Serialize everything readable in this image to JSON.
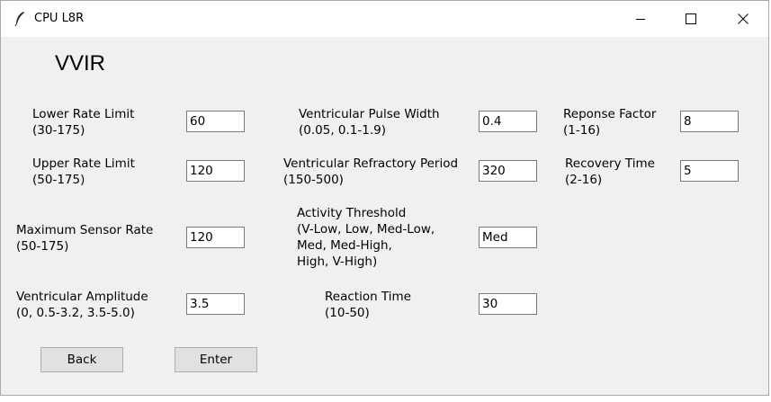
{
  "window": {
    "title": "CPU L8R",
    "icons": {
      "app": "feather-icon",
      "minimize": "minimize-icon",
      "maximize": "maximize-icon",
      "close": "close-icon"
    }
  },
  "mode_title": "VVIR",
  "fields": {
    "lower_rate_limit": {
      "label": "Lower Rate Limit\n(30-175)",
      "value": "60"
    },
    "upper_rate_limit": {
      "label": "Upper Rate Limit\n(50-175)",
      "value": "120"
    },
    "maximum_sensor_rate": {
      "label": "Maximum Sensor Rate\n(50-175)",
      "value": "120"
    },
    "ventricular_amplitude": {
      "label": "Ventricular Amplitude\n(0, 0.5-3.2, 3.5-5.0)",
      "value": "3.5"
    },
    "ventricular_pulse_width": {
      "label": "Ventricular Pulse Width\n(0.05, 0.1-1.9)",
      "value": "0.4"
    },
    "ventricular_refractory_period": {
      "label": "Ventricular Refractory Period\n(150-500)",
      "value": "320"
    },
    "activity_threshold": {
      "label": "Activity Threshold\n(V-Low, Low, Med-Low,\nMed, Med-High,\nHigh, V-High)",
      "value": "Med"
    },
    "reaction_time": {
      "label": "Reaction Time\n(10-50)",
      "value": "30"
    },
    "response_factor": {
      "label": "Reponse Factor\n(1-16)",
      "value": "8"
    },
    "recovery_time": {
      "label": "Recovery Time\n(2-16)",
      "value": "5"
    }
  },
  "buttons": {
    "back": "Back",
    "enter": "Enter"
  }
}
